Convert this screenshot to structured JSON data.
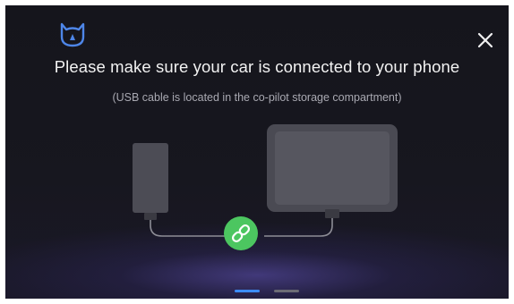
{
  "dialog": {
    "title": "Please make sure your car is connected to your phone",
    "subtitle": "(USB cable is located in the co-pilot storage compartment)"
  },
  "icons": {
    "logo": "brand-logo-icon",
    "close": "close-icon",
    "link": "link-icon"
  },
  "pagination": {
    "total": 2,
    "current": 1
  },
  "colors": {
    "background": "#16161e",
    "accent_blue": "#3c8dff",
    "link_green": "#4cc660",
    "logo_blue": "#4e86e8"
  }
}
